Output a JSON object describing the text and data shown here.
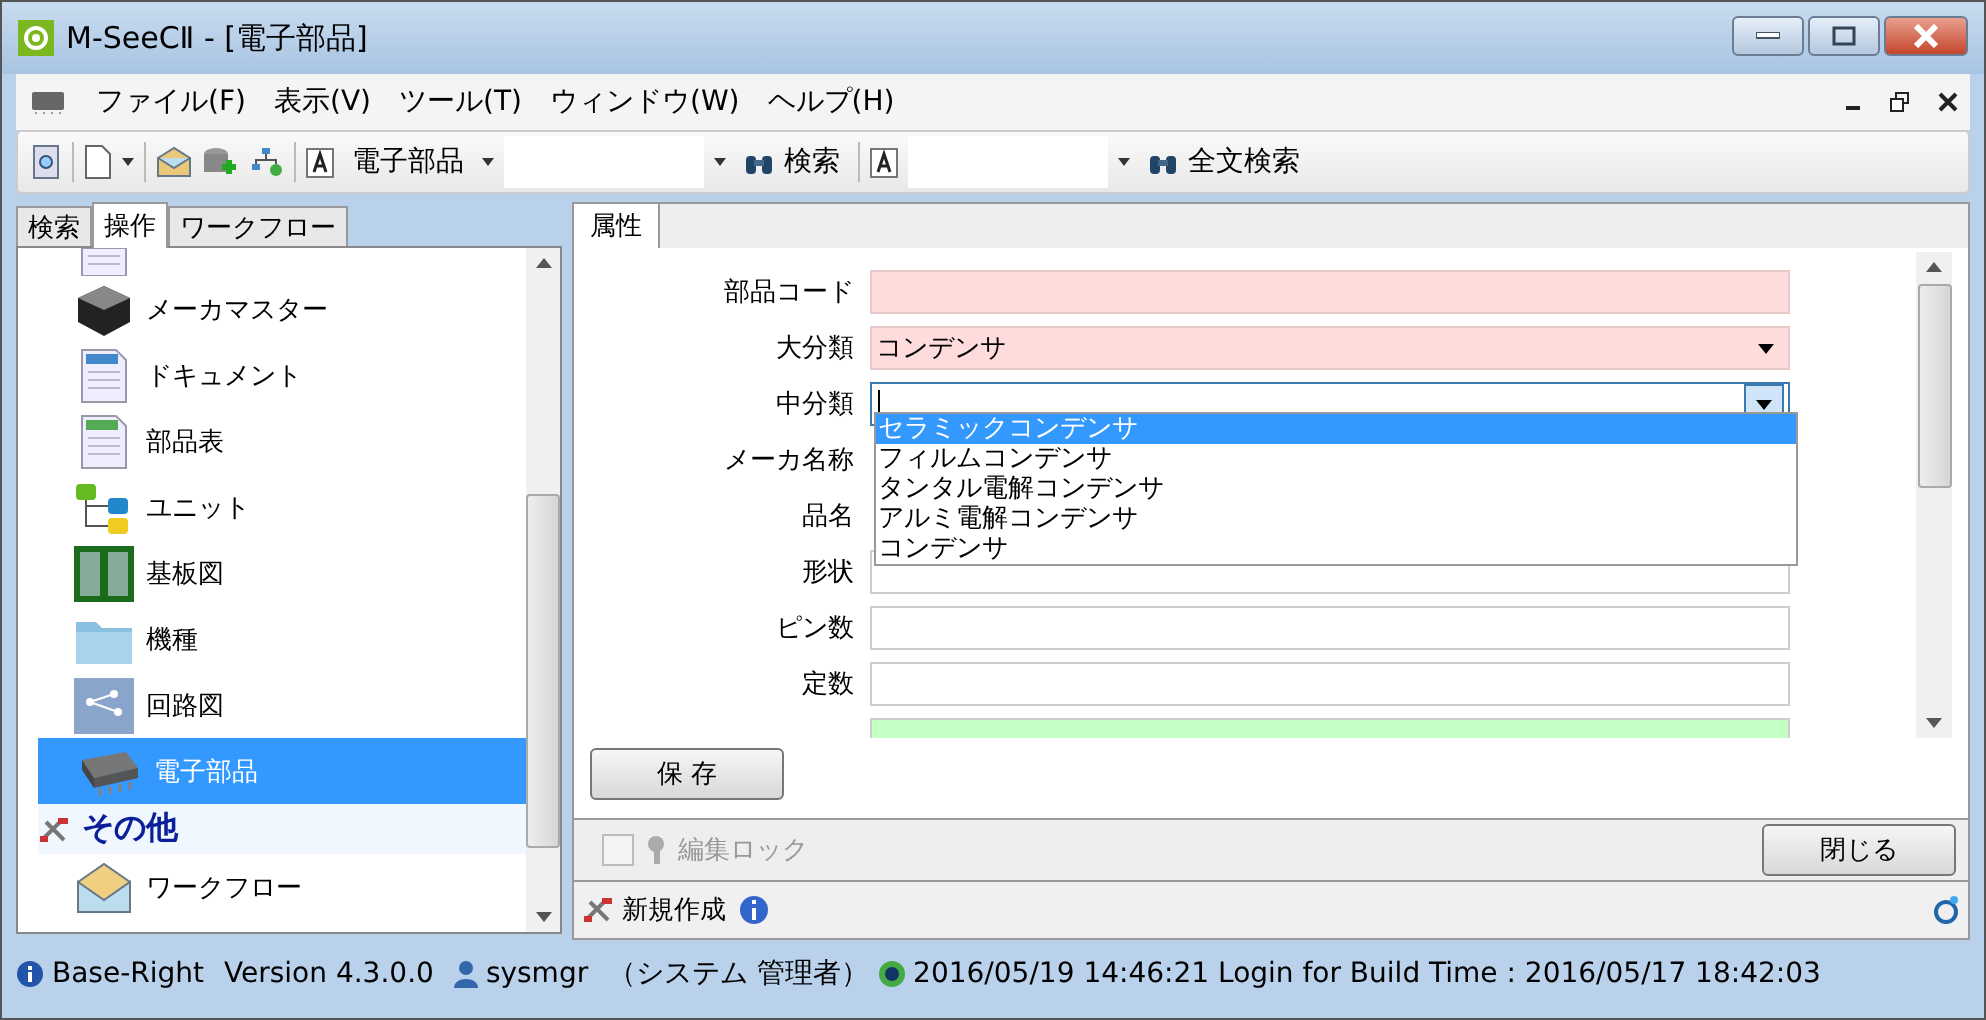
{
  "window": {
    "title": "M-SeeCⅡ - [電子部品]"
  },
  "menu": [
    {
      "label": "ファイル(F)"
    },
    {
      "label": "表示(V)"
    },
    {
      "label": "ツール(T)"
    },
    {
      "label": "ウィンドウ(W)"
    },
    {
      "label": "ヘルプ(H)"
    }
  ],
  "toolbar": {
    "combo_1": "電子部品",
    "search_button": "検索",
    "fulltext_button": "全文検索"
  },
  "left_tabs": [
    {
      "label": "検索",
      "selected": false
    },
    {
      "label": "操作",
      "selected": true
    },
    {
      "label": "ワークフロー",
      "selected": false
    }
  ],
  "tree": [
    {
      "label": "メーカマスター",
      "kind": "item",
      "selected": false
    },
    {
      "label": "ドキュメント",
      "kind": "item",
      "selected": false
    },
    {
      "label": "部品表",
      "kind": "item",
      "selected": false
    },
    {
      "label": "ユニット",
      "kind": "item",
      "selected": false
    },
    {
      "label": "基板図",
      "kind": "item",
      "selected": false
    },
    {
      "label": "機種",
      "kind": "item",
      "selected": false
    },
    {
      "label": "回路図",
      "kind": "item",
      "selected": false
    },
    {
      "label": "電子部品",
      "kind": "item",
      "selected": true
    },
    {
      "label": "その他",
      "kind": "category",
      "selected": false
    },
    {
      "label": "ワークフロー",
      "kind": "item",
      "selected": false
    }
  ],
  "right_tab": {
    "label": "属性",
    "selected": true
  },
  "fields": [
    {
      "label": "部品コード",
      "kind": "text",
      "required": true
    },
    {
      "label": "大分類",
      "kind": "dropdown",
      "required": true,
      "value": "コンデンサ"
    },
    {
      "label": "中分類",
      "kind": "dropdown",
      "required": false,
      "focused": true
    },
    {
      "label": "メーカ名称",
      "kind": "hidden"
    },
    {
      "label": "品名",
      "kind": "hidden"
    },
    {
      "label": "形状",
      "kind": "text",
      "required": false
    },
    {
      "label": "ピン数",
      "kind": "text",
      "required": false
    },
    {
      "label": "定数",
      "kind": "text",
      "required": false
    },
    {
      "kind": "text",
      "required": false,
      "highlighted": true
    }
  ],
  "dropdown_options": [
    {
      "label": "セラミックコンデンサ",
      "selected": true
    },
    {
      "label": "フィルムコンデンサ",
      "selected": false
    },
    {
      "label": "タンタル電解コンデンサ",
      "selected": false
    },
    {
      "label": "アルミ電解コンデンサ",
      "selected": false
    },
    {
      "label": "コンデンサ",
      "selected": false
    }
  ],
  "save_button": "保 存",
  "edit_lock": {
    "label": "編集ロック",
    "checked": false,
    "disabled": true
  },
  "close_button": "閉じる",
  "footer": {
    "new_button": "新規作成"
  },
  "status_bar": {
    "product": "Base-Right",
    "version": "Version 4.3.0.0",
    "user": "sysmgr",
    "role": "（システム 管理者）",
    "login": "2016/05/19 14:46:21 Login for Build Time : 2016/05/17 18:42:03"
  }
}
